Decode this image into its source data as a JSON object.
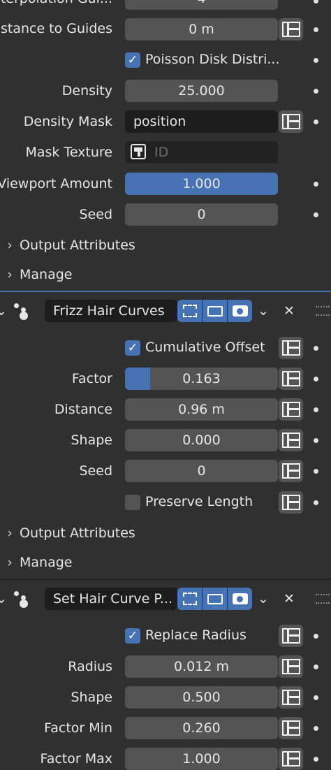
{
  "top": {
    "cut_label": "Interpolation Gui...",
    "cut_value": "4",
    "distance_label": "Distance to Guides",
    "distance_value": "0 m",
    "poisson_label": "Poisson Disk Distri...",
    "density_label": "Density",
    "density_value": "25.000",
    "mask_label": "Density Mask",
    "mask_value": "position",
    "texture_label": "Mask Texture",
    "texture_placeholder": "ID",
    "viewport_label": "Viewport Amount",
    "viewport_value": "1.000",
    "seed_label": "Seed",
    "seed_value": "0",
    "output_label": "Output Attributes",
    "manage_label": "Manage"
  },
  "frizz": {
    "name": "Frizz Hair Curves",
    "cumulative_label": "Cumulative Offset",
    "factor_label": "Factor",
    "factor_value": "0.163",
    "factor_fraction": 0.163,
    "distance_label": "Distance",
    "distance_value": "0.96 m",
    "shape_label": "Shape",
    "shape_value": "0.000",
    "seed_label": "Seed",
    "seed_value": "0",
    "preserve_label": "Preserve Length",
    "output_label": "Output Attributes",
    "manage_label": "Manage"
  },
  "sethair": {
    "name": "Set Hair Curve P...",
    "replace_label": "Replace Radius",
    "radius_label": "Radius",
    "radius_value": "0.012 m",
    "shape_label": "Shape",
    "shape_value": "0.500",
    "fmin_label": "Factor Min",
    "fmin_value": "0.260",
    "fmax_label": "Factor Max",
    "fmax_value": "1.000"
  },
  "colors": {
    "accent": "#4772b3",
    "panel": "#303030",
    "field": "#545454"
  }
}
